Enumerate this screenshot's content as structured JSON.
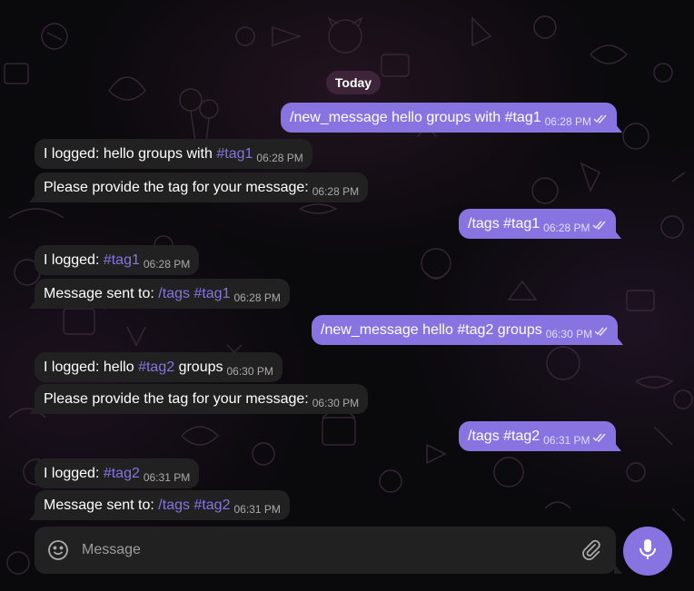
{
  "date_separator": "Today",
  "messages": [
    {
      "dir": "out",
      "parts": [
        "/new_message hello groups with #tag1"
      ],
      "time": "06:28 PM"
    },
    {
      "dir": "in",
      "text_prefix": "I logged: hello groups with ",
      "tag": "#tag1",
      "time": "06:28 PM"
    },
    {
      "dir": "in",
      "text": "Please provide the tag for your message:",
      "time": "06:28 PM"
    },
    {
      "dir": "out",
      "text": "/tags #tag1",
      "time": "06:28 PM"
    },
    {
      "dir": "in",
      "text_prefix": "I logged: ",
      "tag": "#tag1",
      "time": "06:28 PM"
    },
    {
      "dir": "in",
      "text_prefix": "Message sent to: ",
      "tag": "/tags #tag1",
      "time": "06:28 PM"
    },
    {
      "dir": "out",
      "text": "/new_message hello #tag2 groups",
      "time": "06:30 PM"
    },
    {
      "dir": "in",
      "text_prefix": "I logged: hello ",
      "tag": "#tag2",
      "text_suffix": " groups",
      "time": "06:30 PM"
    },
    {
      "dir": "in",
      "text": "Please provide the tag for your message:",
      "time": "06:30 PM"
    },
    {
      "dir": "out",
      "text": "/tags #tag2",
      "time": "06:31 PM"
    },
    {
      "dir": "in",
      "text_prefix": "I logged: ",
      "tag": "#tag2",
      "time": "06:31 PM"
    },
    {
      "dir": "in",
      "text_prefix": "Message sent to: ",
      "tag": "/tags #tag2",
      "time": "06:31 PM"
    }
  ],
  "composer": {
    "placeholder": "Message",
    "emoji_icon": "smile-icon",
    "attach_icon": "paperclip-icon",
    "send_icon": "microphone-icon"
  },
  "colors": {
    "accent": "#8774e1",
    "incoming_bubble": "#212121",
    "date_pill": "#3e2438"
  }
}
